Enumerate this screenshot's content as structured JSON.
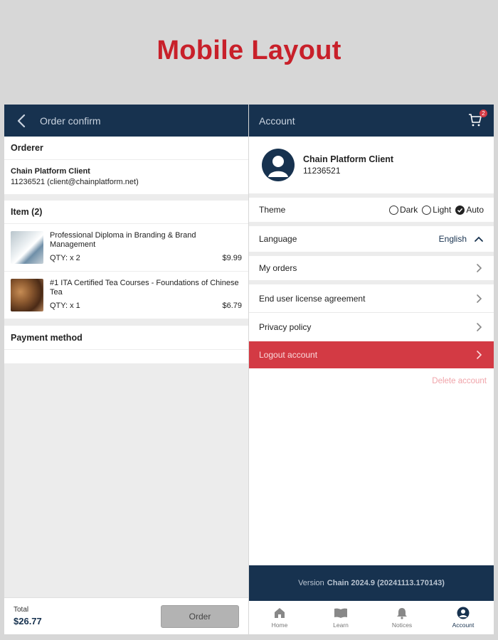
{
  "page_title": "Mobile Layout",
  "order": {
    "header_title": "Order confirm",
    "orderer_heading": "Orderer",
    "orderer_name": "Chain Platform Client",
    "orderer_detail": "11236521 (client@chainplatform.net)",
    "items_heading": "Item (2)",
    "items": [
      {
        "name": "Professional Diploma in Branding & Brand Management",
        "qty": "QTY: x 2",
        "price": "$9.99"
      },
      {
        "name": "#1 ITA Certified Tea Courses - Foundations of Chinese Tea",
        "qty": "QTY: x 1",
        "price": "$6.79"
      }
    ],
    "payment_heading": "Payment method",
    "total_label": "Total",
    "total_value": "$26.77",
    "order_button": "Order"
  },
  "account": {
    "header_title": "Account",
    "cart_badge": "2",
    "profile_name": "Chain Platform Client",
    "profile_id": "11236521",
    "theme_label": "Theme",
    "theme_options": [
      "Dark",
      "Light",
      "Auto"
    ],
    "theme_selected": "Auto",
    "language_label": "Language",
    "language_value": "English",
    "my_orders": "My orders",
    "eula": "End user license agreement",
    "privacy": "Privacy policy",
    "logout": "Logout account",
    "delete": "Delete account",
    "version_prefix": "Version",
    "version_value": "Chain 2024.9 (20241113.170143)",
    "tabs": [
      "Home",
      "Learn",
      "Notices",
      "Account"
    ],
    "active_tab": "Account"
  },
  "colors": {
    "navy": "#17324f",
    "red_title": "#c8202a",
    "logout_red": "#d33a44",
    "delete_pink": "#f0a4aa"
  },
  "icons": [
    "back-arrow-icon",
    "cart-icon",
    "avatar-icon",
    "chevron-up-icon",
    "chevron-right-icon",
    "home-icon",
    "book-icon",
    "bell-icon",
    "account-icon"
  ]
}
